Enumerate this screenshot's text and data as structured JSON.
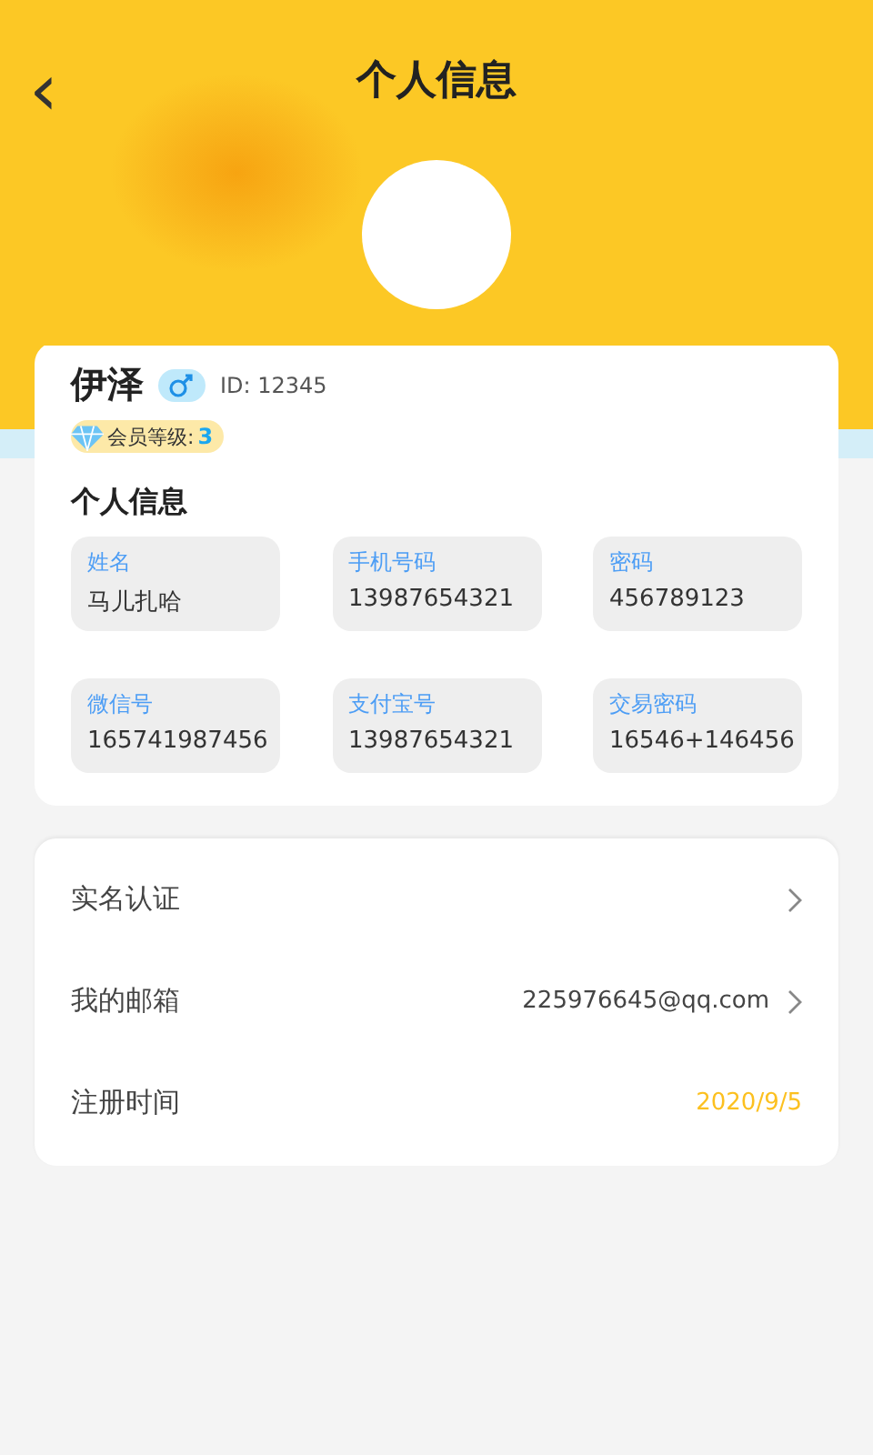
{
  "header": {
    "back": "‹",
    "title": "个人信息"
  },
  "profile": {
    "name": "伊泽",
    "male": true,
    "id": "ID: 12345",
    "member_label": "会员等级:",
    "member_level": "3"
  },
  "info": {
    "title": "个人信息",
    "fields": [
      {
        "label": "姓名",
        "value": "马儿扎哈"
      },
      {
        "label": "手机号码",
        "value": "13987654321"
      },
      {
        "label": "密码",
        "value": "456789123"
      },
      {
        "label": "微信号",
        "value": "165741987456"
      },
      {
        "label": "支付宝号",
        "value": "13987654321"
      },
      {
        "label": "交易密码",
        "value": "16546+146456"
      }
    ]
  },
  "rows": [
    {
      "kind": "link",
      "label": "实名认证"
    },
    {
      "kind": "link",
      "label": "我的邮箱",
      "value": "225976645@qq.com"
    },
    {
      "kind": "info",
      "label": "注册时间",
      "value": "2020/9/5"
    }
  ]
}
